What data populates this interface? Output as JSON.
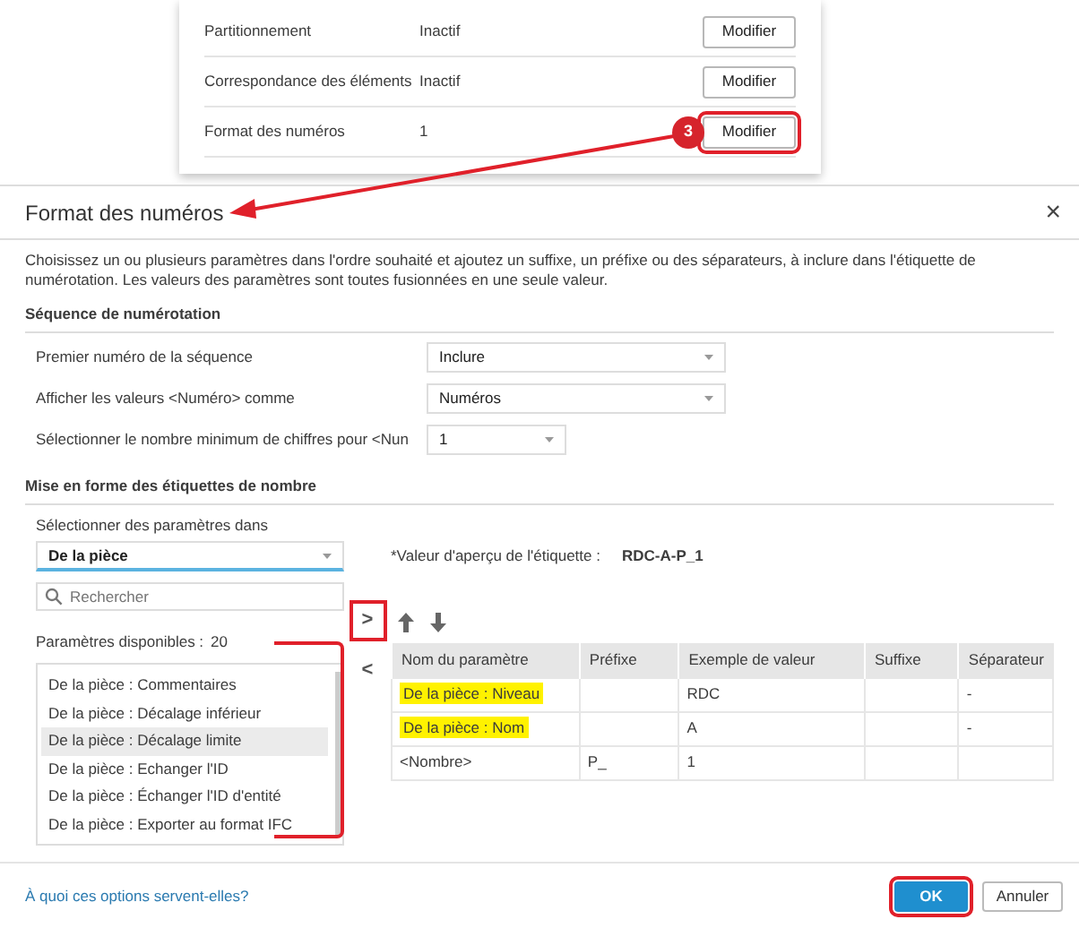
{
  "settings_card": {
    "rows": [
      {
        "label": "Partitionnement",
        "value": "Inactif",
        "button": "Modifier",
        "annotated": false
      },
      {
        "label": "Correspondance des éléments",
        "value": "Inactif",
        "button": "Modifier",
        "annotated": false
      },
      {
        "label": "Format des numéros",
        "value": "1",
        "button": "Modifier",
        "annotated": true
      }
    ]
  },
  "step_badge": "3",
  "dialog": {
    "title": "Format des numéros",
    "close": "×",
    "description": "Choisissez un ou plusieurs paramètres dans l'ordre souhaité et ajoutez un suffixe, un préfixe ou des séparateurs, à inclure dans l'étiquette de numérotation. Les valeurs des paramètres sont toutes fusionnées en une seule valeur.",
    "sequence_section": {
      "title": "Séquence de numérotation",
      "fields": [
        {
          "label": "Premier numéro de la séquence",
          "value": "Inclure",
          "wide": true
        },
        {
          "label": "Afficher les valeurs <Numéro> comme",
          "value": "Numéros",
          "wide": true
        },
        {
          "label": "Sélectionner le nombre minimum de chiffres pour <Nun",
          "value": "1",
          "wide": false
        }
      ]
    },
    "format_section": {
      "title": "Mise en forme des étiquettes de nombre",
      "source_label": "Sélectionner des paramètres dans",
      "source_value": "De la pièce",
      "search_placeholder": "Rechercher",
      "available_label": "Paramètres disponibles :",
      "available_count": "20",
      "available_annotated": true,
      "available": [
        {
          "text": "De la pièce : Commentaires",
          "selected": false
        },
        {
          "text": "De la pièce : Décalage inférieur",
          "selected": false
        },
        {
          "text": "De la pièce : Décalage limite",
          "selected": true
        },
        {
          "text": "De la pièce : Echanger l'ID",
          "selected": false
        },
        {
          "text": "De la pièce : Échanger l'ID d'entité",
          "selected": false
        },
        {
          "text": "De la pièce : Exporter au format IFC",
          "selected": false
        }
      ],
      "add_button": {
        "text": ">",
        "annotated": true
      },
      "remove_button": {
        "text": "<"
      },
      "preview_label": "*Valeur d'aperçu de l'étiquette :",
      "preview_value": "RDC-A-P_1",
      "table": {
        "columns": [
          "Nom du paramètre",
          "Préfixe",
          "Exemple de valeur",
          "Suffixe",
          "Séparateur"
        ],
        "rows": [
          {
            "cells": [
              "De la pièce : Niveau",
              "",
              "RDC",
              "",
              "-"
            ],
            "highlighted": true
          },
          {
            "cells": [
              "De la pièce : Nom",
              "",
              "A",
              "",
              "-"
            ],
            "highlighted": true
          },
          {
            "cells": [
              "<Nombre>",
              "P_",
              "1",
              "",
              ""
            ],
            "highlighted": false
          }
        ]
      }
    },
    "help_link": "À quoi ces options servent-elles?",
    "buttons": [
      {
        "text": "OK",
        "kind": "primary",
        "annotated": true
      },
      {
        "text": "Annuler",
        "kind": "secondary",
        "annotated": false
      }
    ]
  }
}
